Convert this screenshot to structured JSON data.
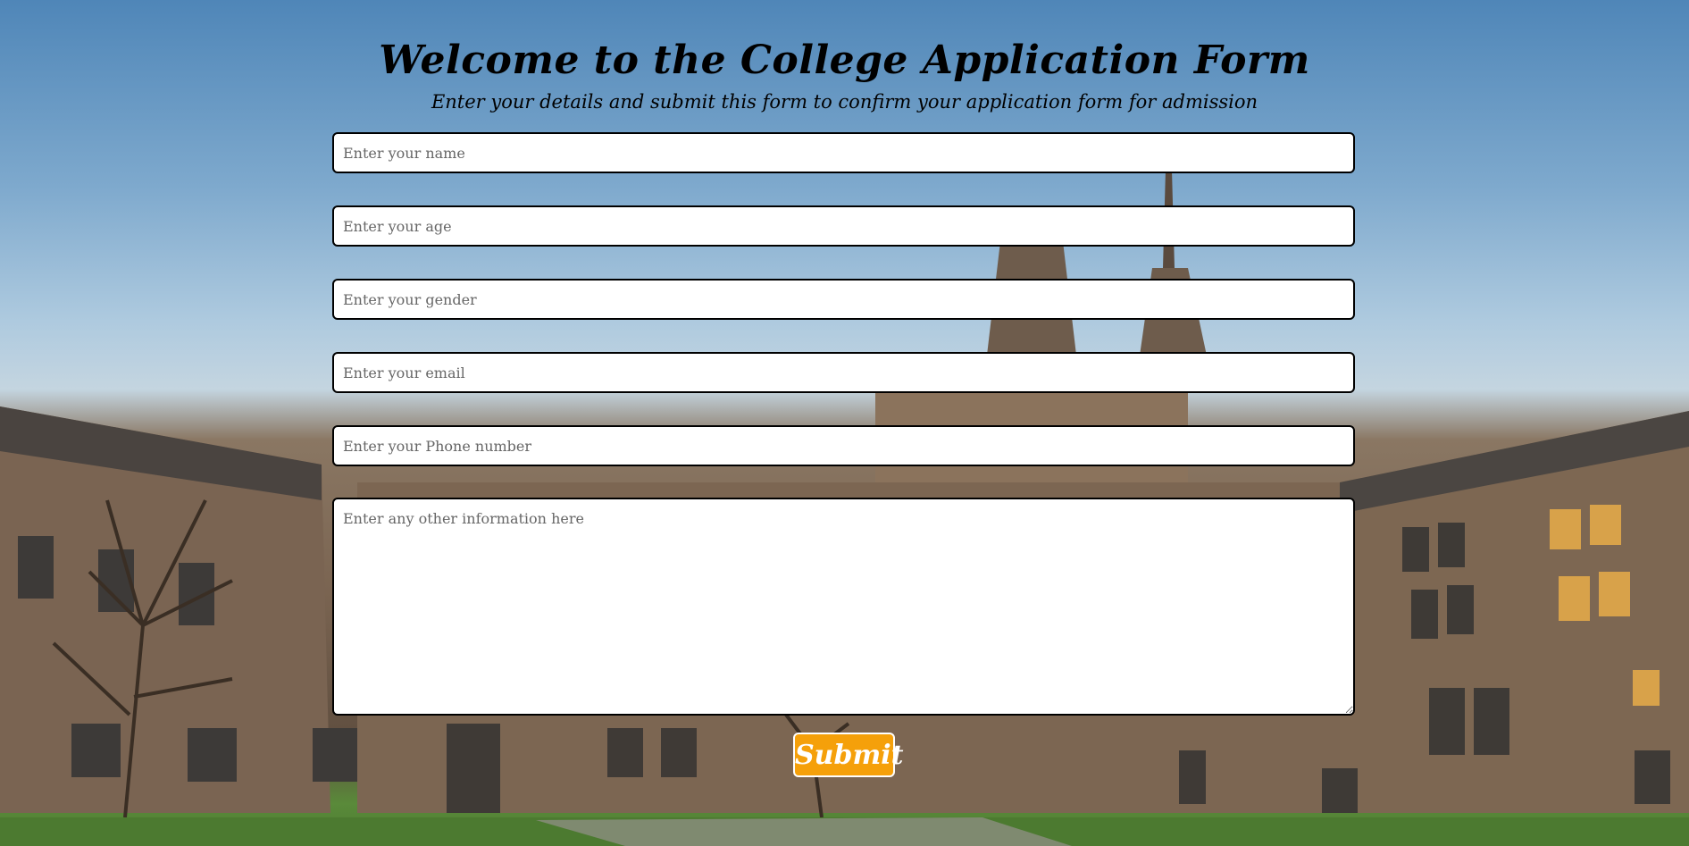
{
  "page": {
    "title": "Welcome to the College Application Form",
    "subtitle": "Enter your details and submit this form to confirm your application form for admission"
  },
  "form": {
    "name_placeholder": "Enter your name",
    "age_placeholder": "Enter your age",
    "gender_placeholder": "Enter your gender",
    "email_placeholder": "Enter your email",
    "phone_placeholder": "Enter your Phone number",
    "other_placeholder": "Enter any other information here",
    "submit_label": "Submit"
  },
  "colors": {
    "submit_background": "#f5a00a",
    "submit_text": "#ffffff",
    "field_border": "#000000"
  },
  "background": {
    "type": "photo",
    "subject": "college-campus-building"
  }
}
